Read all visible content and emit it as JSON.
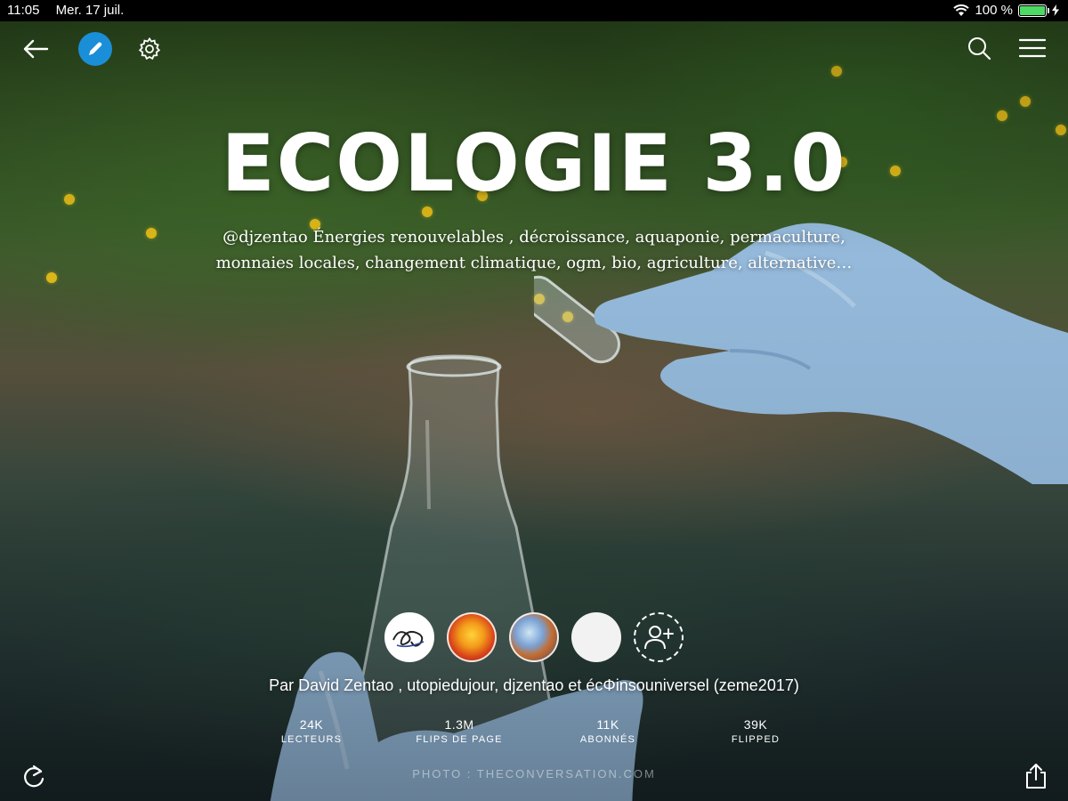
{
  "status_bar": {
    "time": "11:05",
    "date": "Mer. 17 juil.",
    "battery": "100 %"
  },
  "toolbar": {
    "left": [
      "back-arrow-icon",
      "pencil-icon",
      "gear-icon"
    ],
    "right": [
      "search-icon",
      "hamburger-menu-icon"
    ],
    "accent_color": "#1a8fd8"
  },
  "magazine": {
    "title": "ECOLOGIE 3.0",
    "description": "@djzentao Énergies renouvelables , décroissance, aquaponie, permaculture, monnaies locales, changement climatique, ogm, bio, agriculture, alternative…",
    "byline": "Par David Zentao , utopiedujour, djzentao et écΦinsouniversel (zeme2017)",
    "photo_credit": "PHOTO : THECONVERSATION.COM"
  },
  "contributors": [
    "avatar-1",
    "avatar-2",
    "avatar-3",
    "avatar-4",
    "add-contributor-icon"
  ],
  "stats": [
    {
      "value": "24K",
      "label": "LECTEURS"
    },
    {
      "value": "1.3M",
      "label": "FLIPS DE PAGE"
    },
    {
      "value": "11K",
      "label": "ABONNÉS"
    },
    {
      "value": "39K",
      "label": "FLIPPED"
    }
  ],
  "bottom_bar": {
    "left": "refresh-icon",
    "right": "share-icon"
  }
}
